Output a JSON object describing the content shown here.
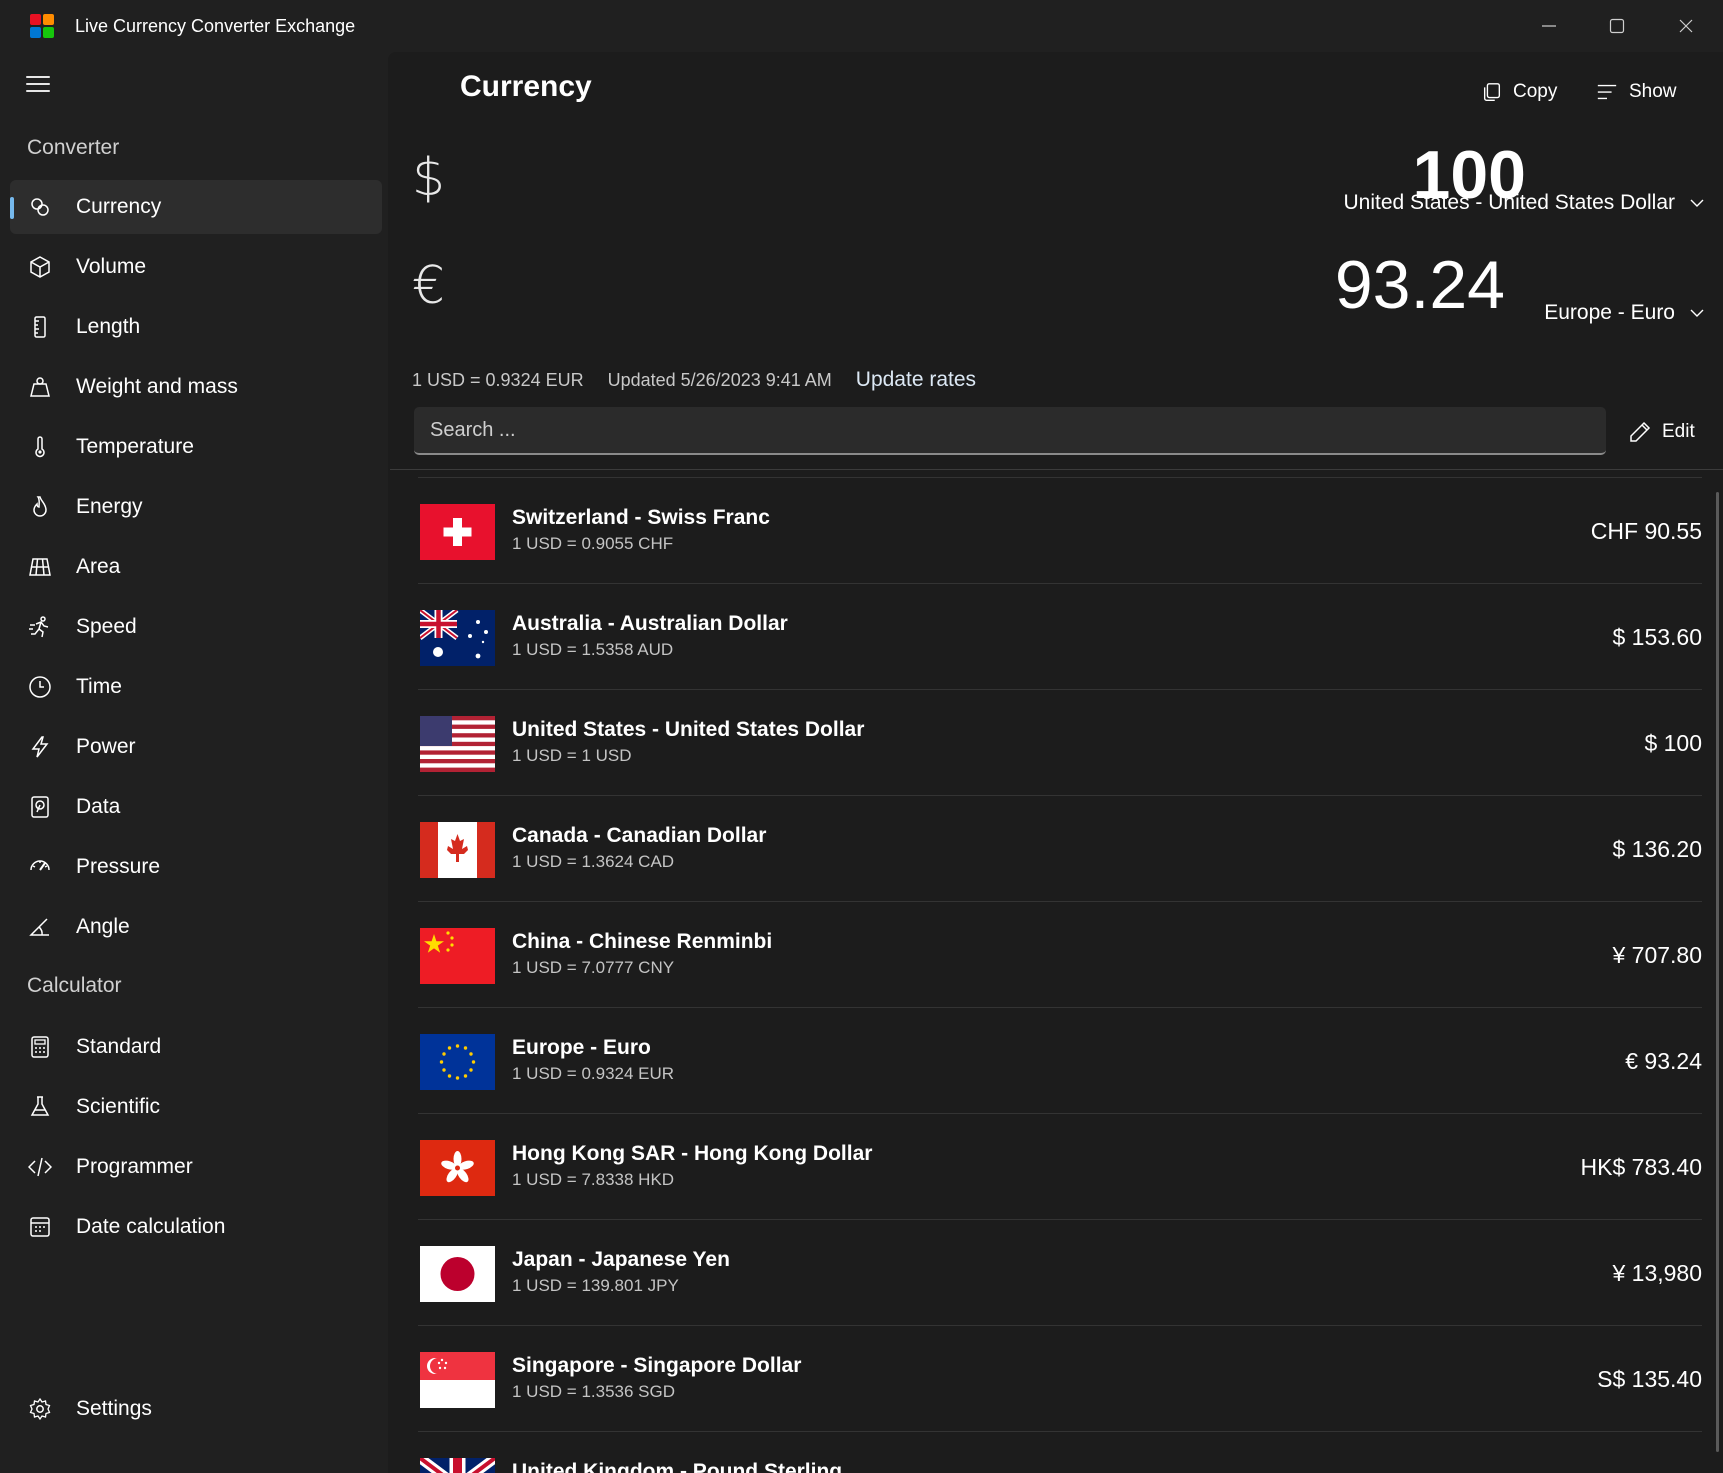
{
  "window": {
    "title": "Live Currency Converter Exchange",
    "logo_colors": [
      "#e81123",
      "#ff8c00",
      "#0078d4",
      "#16c60c"
    ]
  },
  "sidebar": {
    "sections": {
      "converter": "Converter",
      "calculator": "Calculator"
    },
    "converter_items": [
      {
        "label": "Currency",
        "icon": "currency-icon",
        "active": true
      },
      {
        "label": "Volume",
        "icon": "cube-icon"
      },
      {
        "label": "Length",
        "icon": "ruler-icon"
      },
      {
        "label": "Weight and mass",
        "icon": "weight-icon"
      },
      {
        "label": "Temperature",
        "icon": "thermometer-icon"
      },
      {
        "label": "Energy",
        "icon": "flame-icon"
      },
      {
        "label": "Area",
        "icon": "grid-area-icon"
      },
      {
        "label": "Speed",
        "icon": "running-icon"
      },
      {
        "label": "Time",
        "icon": "clock-icon"
      },
      {
        "label": "Power",
        "icon": "lightning-icon"
      },
      {
        "label": "Data",
        "icon": "data-drive-icon"
      },
      {
        "label": "Pressure",
        "icon": "gauge-icon"
      },
      {
        "label": "Angle",
        "icon": "angle-icon"
      }
    ],
    "calculator_items": [
      {
        "label": "Standard",
        "icon": "calculator-icon"
      },
      {
        "label": "Scientific",
        "icon": "flask-icon"
      },
      {
        "label": "Programmer",
        "icon": "code-icon"
      },
      {
        "label": "Date calculation",
        "icon": "calendar-icon"
      }
    ],
    "settings": {
      "label": "Settings",
      "icon": "gear-icon"
    }
  },
  "main": {
    "title": "Currency",
    "copy_label": "Copy",
    "show_label": "Show",
    "from": {
      "symbol": "$",
      "value": "100",
      "currency": "United States - United States Dollar"
    },
    "to": {
      "symbol": "€",
      "value": "93.24",
      "currency": "Europe - Euro"
    },
    "rate_text": "1 USD = 0.9324 EUR",
    "updated_text": "Updated 5/26/2023 9:41 AM",
    "update_rates_label": "Update rates",
    "search_placeholder": "Search ...",
    "edit_label": "Edit",
    "accent_color": "#76b9ed"
  },
  "currencies": [
    {
      "name": "Switzerland - Swiss Franc",
      "rate": "1 USD = 0.9055 CHF",
      "amount": "CHF 90.55",
      "flag": "switzerland"
    },
    {
      "name": "Australia - Australian Dollar",
      "rate": "1 USD = 1.5358 AUD",
      "amount": "$ 153.60",
      "flag": "australia"
    },
    {
      "name": "United States - United States Dollar",
      "rate": "1 USD = 1 USD",
      "amount": "$ 100",
      "flag": "united-states"
    },
    {
      "name": "Canada - Canadian Dollar",
      "rate": "1 USD = 1.3624 CAD",
      "amount": "$ 136.20",
      "flag": "canada"
    },
    {
      "name": "China - Chinese Renminbi",
      "rate": "1 USD = 7.0777 CNY",
      "amount": "¥ 707.80",
      "flag": "china"
    },
    {
      "name": "Europe - Euro",
      "rate": "1 USD = 0.9324 EUR",
      "amount": "€ 93.24",
      "flag": "europe"
    },
    {
      "name": "Hong Kong SAR - Hong Kong Dollar",
      "rate": "1 USD = 7.8338 HKD",
      "amount": "HK$ 783.40",
      "flag": "hong-kong"
    },
    {
      "name": "Japan - Japanese Yen",
      "rate": "1 USD = 139.801 JPY",
      "amount": "¥ 13,980",
      "flag": "japan"
    },
    {
      "name": "Singapore - Singapore Dollar",
      "rate": "1 USD = 1.3536 SGD",
      "amount": "S$ 135.40",
      "flag": "singapore"
    },
    {
      "name": "United Kingdom - Pound Sterling",
      "rate": "",
      "amount": "",
      "flag": "united-kingdom"
    }
  ]
}
